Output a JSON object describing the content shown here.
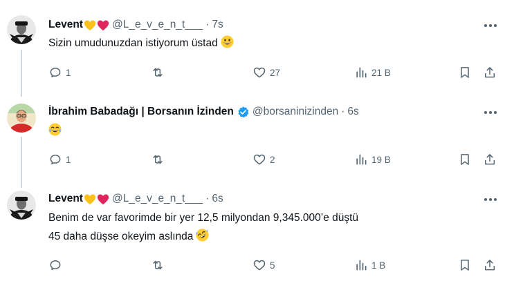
{
  "tweets": [
    {
      "name": "Levent",
      "handle": "@L_e_v_e_n_t___",
      "time": "7s",
      "text_lines": [
        "Sizin umudunuzdan istiyorum üstad"
      ],
      "emoji": "grinning-face",
      "replies": "1",
      "retweets": "",
      "likes": "27",
      "views": "21 B"
    },
    {
      "name": "İbrahim Babadağı | Borsanın İzinden",
      "handle": "@borsaninizinden",
      "time": "6s",
      "verified": true,
      "text_lines": [
        ""
      ],
      "emoji": "tears-of-joy-face",
      "replies": "1",
      "retweets": "",
      "likes": "2",
      "views": "19 B"
    },
    {
      "name": "Levent",
      "handle": "@L_e_v_e_n_t___",
      "time": "6s",
      "text_lines": [
        "Benim de var favorimde bir yer 12,5 milyondan 9,345.000’e düştü",
        "45 daha düşse okeyim aslında"
      ],
      "emoji": "rolling-on-floor-laughing-face",
      "replies": "",
      "retweets": "",
      "likes": "5",
      "views": "1 B"
    }
  ],
  "separator": "·",
  "colors": {
    "text": "#0f1419",
    "muted": "#536471",
    "verified": "#1d9bf0",
    "line": "#cfd9de"
  }
}
